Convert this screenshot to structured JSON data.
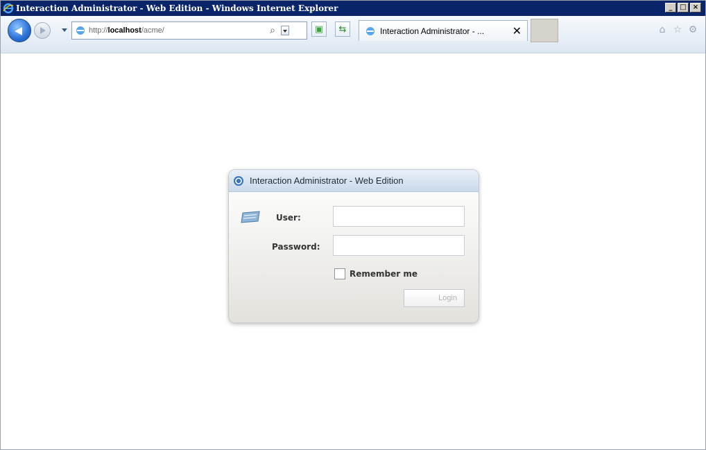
{
  "window": {
    "title": "Interaction Administrator - Web Edition - Windows Internet Explorer",
    "controls": {
      "minimize": "_",
      "maximize": "□",
      "close": "×"
    }
  },
  "address_bar": {
    "url_prefix": "http://",
    "url_host": "localhost",
    "url_path": "/acme/"
  },
  "tab": {
    "label": "Interaction Administrator - ...",
    "close": "✕"
  },
  "dialog": {
    "title": "Interaction Administrator - Web Edition",
    "user_label": "User:",
    "password_label": "Password:",
    "user_value": "",
    "password_value": "",
    "remember_label": "Remember me",
    "remember_checked": false,
    "login_label": "Login"
  },
  "colors": {
    "titlebar": "#0a246a",
    "dialog_header": "#c9d9ea",
    "accent_blue": "#2a6fd6"
  },
  "icons": [
    "ie-logo-icon",
    "back-arrow-icon",
    "forward-arrow-icon",
    "page-icon",
    "search-icon",
    "compatibility-view-icon",
    "refresh-icon",
    "home-icon",
    "favorites-star-icon",
    "gear-icon",
    "keyboard-icon",
    "app-logo-icon"
  ]
}
